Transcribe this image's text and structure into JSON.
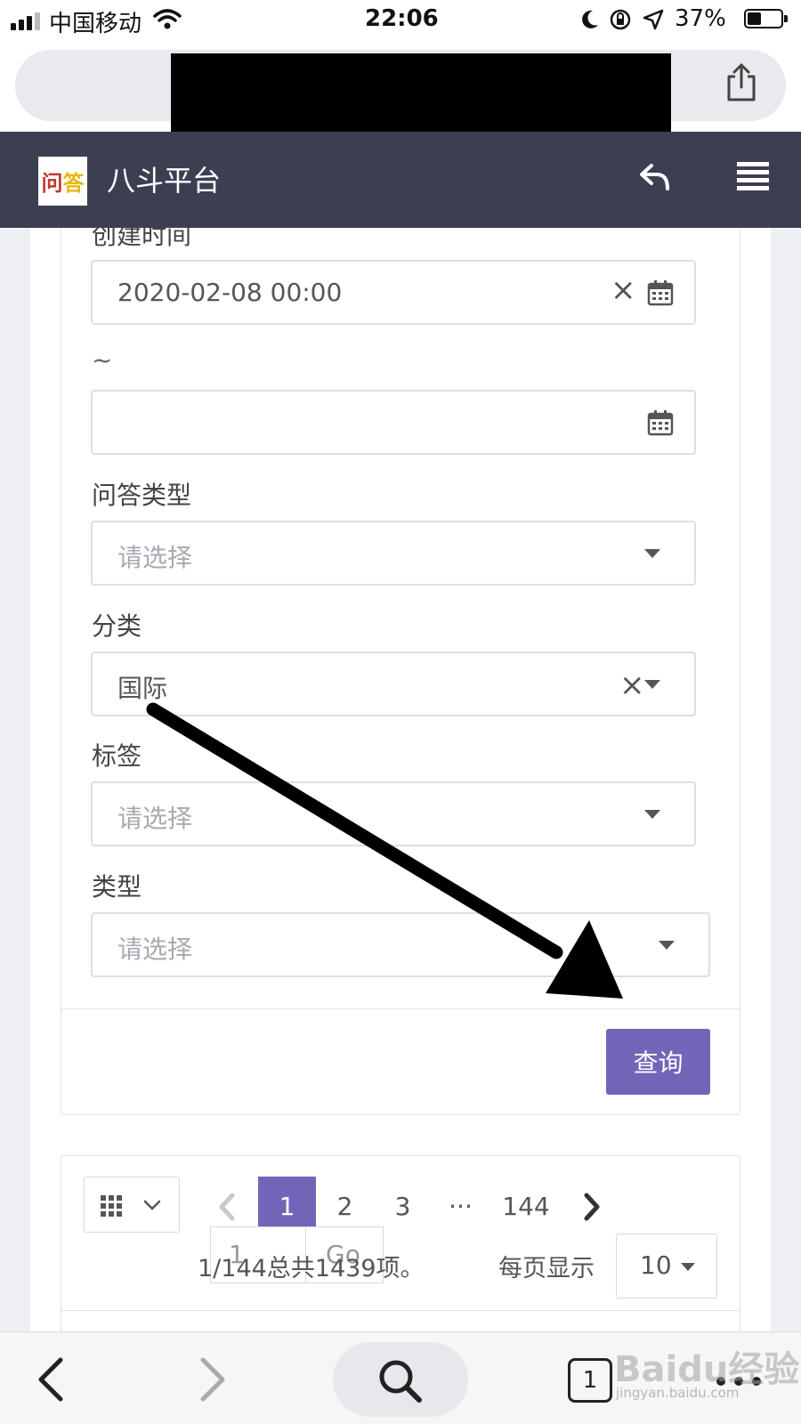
{
  "status_bar": {
    "carrier": "中国移动",
    "time": "22:06",
    "battery": "37%"
  },
  "app_header": {
    "logo_text": "问答",
    "title": "八斗平台"
  },
  "form": {
    "created_time_label": "创建时间",
    "start_date_value": "2020-02-08 00:00",
    "range_separator": "~",
    "end_date_value": "",
    "qa_type_label": "问答类型",
    "qa_type_placeholder": "请选择",
    "category_label": "分类",
    "category_value": "国际",
    "tag_label": "标签",
    "tag_placeholder": "请选择",
    "type_label": "类型",
    "type_placeholder": "请选择",
    "query_button": "查询"
  },
  "pagination": {
    "pages": [
      "1",
      "2",
      "3",
      "···",
      "144"
    ],
    "active_page": "1",
    "goto_value": "1",
    "go_button": "Go",
    "total_text": "1/144总共1439项。",
    "per_page_label": "每页显示",
    "per_page_value": "10"
  },
  "toolbar": {
    "tab_count": "1"
  },
  "watermark": {
    "brand": "Baidu经验",
    "url": "jingyan.baidu.com"
  },
  "colors": {
    "header_bg": "#3c3f52",
    "accent": "#7065b7",
    "annotation_arrow": "#000000"
  }
}
